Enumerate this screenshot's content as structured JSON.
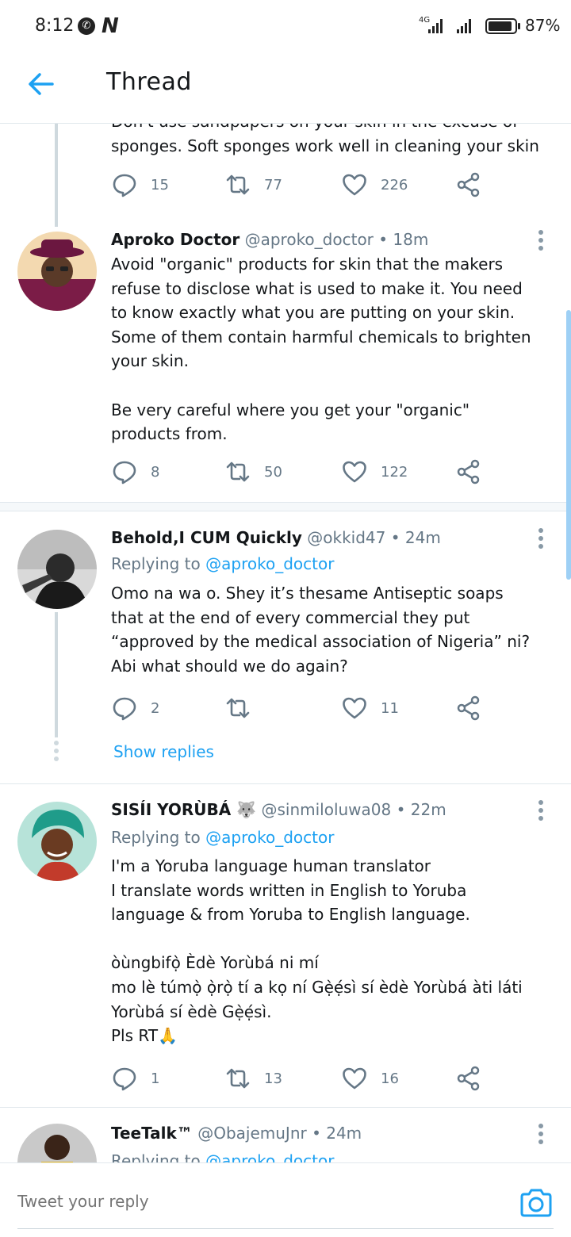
{
  "status_bar": {
    "time": "8:12",
    "network": "4G",
    "battery": "87%",
    "app_icons": [
      "whatsapp-icon",
      "n-app-icon"
    ]
  },
  "header": {
    "title": "Thread"
  },
  "colors": {
    "accent": "#1da1f2",
    "muted": "#657786",
    "text": "#14171a",
    "divider": "#e1e8ed"
  },
  "tweets": [
    {
      "body": "Don't use sandpapers on your skin in the excuse of\nsponges. Soft sponges work well in cleaning your skin",
      "replies": "15",
      "retweets": "77",
      "likes": "226"
    },
    {
      "name": "Aproko Doctor",
      "handle": "@aproko_doctor",
      "dot": "•",
      "time": "18m",
      "body": "Avoid \"organic\" products for skin that the makers\nrefuse to disclose what is used to make it. You need\nto know exactly what you are putting on your skin.\nSome of them contain harmful chemicals to brighten\nyour skin.\n\nBe very careful where you get your \"organic\"\nproducts from.",
      "replies": "8",
      "retweets": "50",
      "likes": "122"
    },
    {
      "name": "Behold,I CUM Quickly",
      "handle": "@okkid47",
      "dot": "•",
      "time": "24m",
      "replying_label": "Replying to",
      "replying_to": "@aproko_doctor",
      "body": "Omo na wa o. Shey it’s thesame Antiseptic soaps\nthat at the end of every commercial they put\n“approved by the medical association of Nigeria” ni?\nAbi what should we do again?",
      "replies": "2",
      "retweets": "",
      "likes": "11",
      "show_replies": "Show replies"
    },
    {
      "name": "SISÍI YORÙBÁ 🐺",
      "handle": "@sinmiloluwa08",
      "dot": "•",
      "time": "22m",
      "replying_label": "Replying to",
      "replying_to": "@aproko_doctor",
      "body": "I'm a Yoruba language human translator\nI translate words written in English to Yoruba\nlanguage & from Yoruba to English language.\n\nòùngbifọ̀ Èdè Yorùbá ni mí\nmo lè túmọ̀ ọ̀rọ̀ tí a kọ ní Gẹ̀ẹ́sì sí èdè Yorùbá àti láti\nYorùbá sí èdè Gẹ̀ẹ́sì.\nPls RT🙏",
      "replies": "1",
      "retweets": "13",
      "likes": "16"
    },
    {
      "name": "TeeTalk™",
      "handle": "@ObajemuJnr",
      "dot": "•",
      "time": "24m",
      "replying_label": "Replying to",
      "replying_to": "@aproko_doctor"
    }
  ],
  "composer": {
    "placeholder": "Tweet your reply"
  }
}
